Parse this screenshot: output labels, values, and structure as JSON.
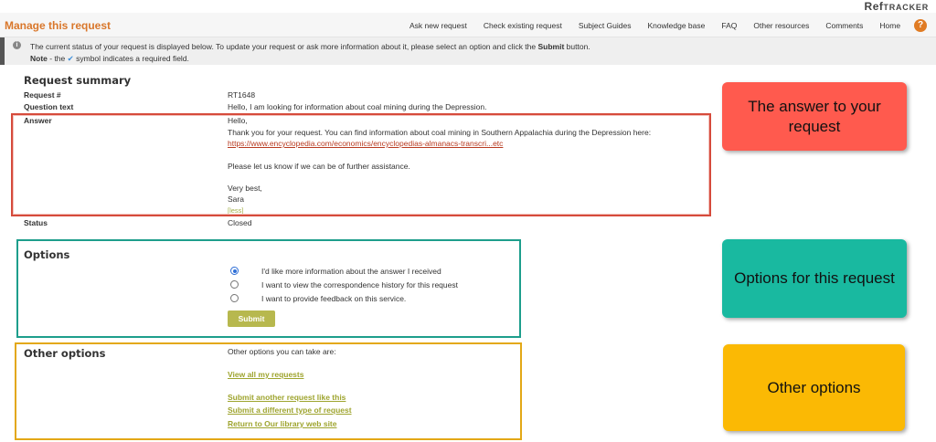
{
  "brand": {
    "logo_main": "Ref",
    "logo_rest": "TRACKER"
  },
  "header": {
    "title": "Manage this request",
    "nav": [
      "Ask new request",
      "Check existing request",
      "Subject Guides",
      "Knowledge base",
      "FAQ",
      "Other resources",
      "Comments",
      "Home"
    ],
    "help_label": "?"
  },
  "info": {
    "line1_prefix": "The current status of your request is displayed below. To update your request or ask more information about it, please select an option and click the ",
    "line1_bold": "Submit",
    "line1_suffix": " button.",
    "note_label": "Note",
    "note_prefix": " - the ",
    "note_glyph": "✔",
    "note_suffix": " symbol indicates a required field."
  },
  "summary": {
    "heading": "Request summary",
    "request_label": "Request #",
    "request_value": "RT1648",
    "question_label": "Question text",
    "question_value": "Hello, I am looking for information about coal mining during the Depression.",
    "answer_label": "Answer",
    "answer_greeting": "Hello,",
    "answer_body": "Thank you for your request. You can find information about coal mining in Southern Appalachia during the Depression here:",
    "answer_link": "https://www.encyclopedia.com/economics/encyclopedias-almanacs-transcri...etc",
    "answer_followup": "Please let us know if we can be of further assistance.",
    "answer_closing": "Very best,",
    "answer_signature": "Sara",
    "less_label": "[less]",
    "status_label": "Status",
    "status_value": "Closed"
  },
  "options": {
    "heading": "Options",
    "items": [
      {
        "label": "I'd like more information about the answer I received",
        "checked": true
      },
      {
        "label": "I want to view the correspondence history for this request",
        "checked": false
      },
      {
        "label": "I want to provide feedback on this service.",
        "checked": false
      }
    ],
    "submit_label": "Submit"
  },
  "other_options": {
    "heading": "Other options",
    "intro": "Other options you can take are:",
    "links": [
      "View all my requests",
      "Submit another request like this",
      "Submit a different type of request",
      "Return to Our library web site"
    ]
  },
  "callouts": {
    "answer": "The answer to your request",
    "options": "Options for this request",
    "other": "Other options"
  },
  "colors": {
    "brand_orange": "#d9772b",
    "red": "#ff5a4e",
    "green": "#19b9a0",
    "yellow": "#fbb904",
    "link_red": "#b83a20",
    "link_olive": "#9ea42e"
  }
}
